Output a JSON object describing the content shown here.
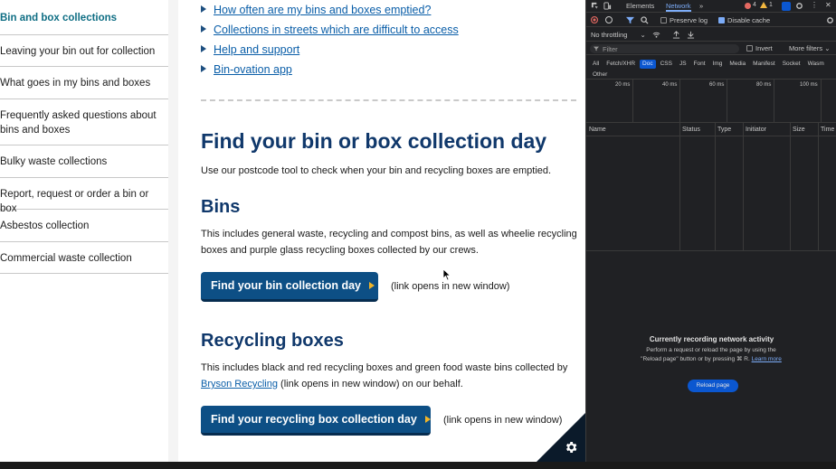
{
  "sidebar": {
    "items": [
      {
        "label": "Bin and box collections",
        "active": true
      },
      {
        "label": "Leaving your bin out for collection",
        "active": false
      },
      {
        "label": "What goes in my bins and boxes",
        "active": false
      },
      {
        "label": "Frequently asked questions about bins and boxes",
        "active": false
      },
      {
        "label": "Bulky waste collections",
        "active": false
      },
      {
        "label": "Report, request or order a bin or box",
        "active": false
      },
      {
        "label": "Asbestos collection",
        "active": false
      },
      {
        "label": "Commercial waste collection",
        "active": false
      }
    ]
  },
  "faq_links": [
    "How often are my bins and boxes emptied?",
    "Collections in streets which are difficult to access",
    "Help and support",
    "Bin-ovation app"
  ],
  "main": {
    "title": "Find your bin or box collection day",
    "intro": "Use our postcode tool to check when your bin and recycling boxes are emptied.",
    "bins": {
      "heading": "Bins",
      "text": "This includes general waste, recycling and compost bins, as well as wheelie recycling boxes and purple glass recycling boxes collected by our crews.",
      "button_label": "Find your bin collection day",
      "note": "(link opens in new window)"
    },
    "recycling": {
      "heading": "Recycling boxes",
      "text_before": "This includes black and red recycling boxes and green food waste bins collected by",
      "link": "Bryson Recycling",
      "text_after": "(link opens in new window) on our behalf.",
      "button_label": "Find your recycling box collection day",
      "note": "(link opens in new window)"
    }
  },
  "devtools": {
    "tabs": [
      "Elements",
      "Network"
    ],
    "more_tabs": "»",
    "error_count": "4",
    "warning_count": "1",
    "preserve_log": "Preserve log",
    "disable_cache": "Disable cache",
    "throttling": "No throttling",
    "filter_placeholder": "Filter",
    "invert": "Invert",
    "more_filters": "More filters",
    "type_filters": [
      "All",
      "Fetch/XHR",
      "Doc",
      "CSS",
      "JS",
      "Font",
      "Img",
      "Media",
      "Manifest",
      "Socket",
      "Wasm",
      "Other"
    ],
    "selected_filter": "Doc",
    "timeline_labels": [
      "20 ms",
      "40 ms",
      "60 ms",
      "80 ms",
      "100 ms"
    ],
    "columns": [
      "Name",
      "Status",
      "Type",
      "Initiator",
      "Size",
      "Time"
    ],
    "recording_title": "Currently recording network activity",
    "recording_body": "Perform a request or reload the page by using the \"Reload page\" button or by pressing ⌘ R.",
    "learn_more": "Learn more",
    "reload_button": "Reload page",
    "colors": {
      "accent": "#7cacf8",
      "button": "#0b57d0",
      "background": "#202124"
    }
  },
  "colors": {
    "heading": "#10386b",
    "button": "#0d4f85",
    "link": "#0a5ea8",
    "arrow": "#f0b429",
    "sidebar_active": "#0f6e84"
  }
}
